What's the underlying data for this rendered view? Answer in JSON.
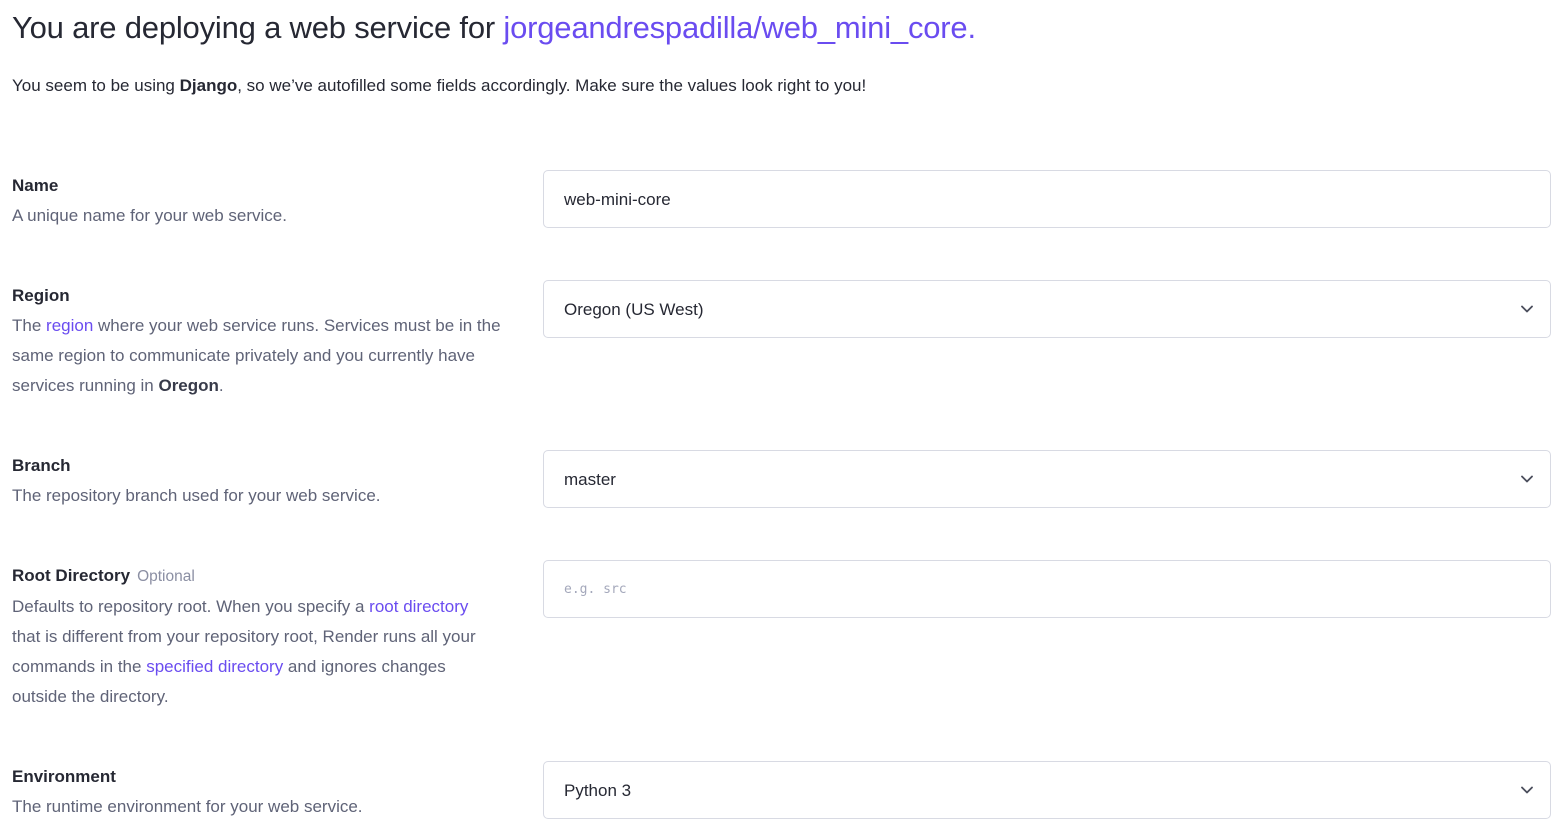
{
  "header": {
    "title_prefix": "You are deploying a web service for ",
    "repo": "jorgeandrespadilla/web_mini_core.",
    "intro_before": "You seem to be using ",
    "intro_framework": "Django",
    "intro_after": ", so we’ve autofilled some fields accordingly. Make sure the values look right to you!"
  },
  "fields": {
    "name": {
      "label": "Name",
      "description": "A unique name for your web service.",
      "value": "web-mini-core"
    },
    "region": {
      "label": "Region",
      "desc_1": "The ",
      "desc_link": "region",
      "desc_2": " where your web service runs. Services must be in the same region to communicate privately and you currently have services running in ",
      "desc_bold": "Oregon",
      "desc_3": ".",
      "value": "Oregon (US West)"
    },
    "branch": {
      "label": "Branch",
      "description": "The repository branch used for your web service.",
      "value": "master"
    },
    "root_directory": {
      "label": "Root Directory",
      "optional": "Optional",
      "desc_1": "Defaults to repository root. When you specify a ",
      "desc_link1": "root directory",
      "desc_2": " that is different from your repository root, Render runs all your commands in the ",
      "desc_link2": "specified directory",
      "desc_3": " and ignores changes outside the directory.",
      "placeholder": "e.g. src"
    },
    "environment": {
      "label": "Environment",
      "description": "The runtime environment for your web service.",
      "value": "Python 3"
    }
  },
  "icons": {
    "chevron": "chevron-down-icon"
  },
  "colors": {
    "accent": "#6a4cf0",
    "text": "#262833",
    "muted": "#5f6377",
    "border": "#d8dae3"
  }
}
